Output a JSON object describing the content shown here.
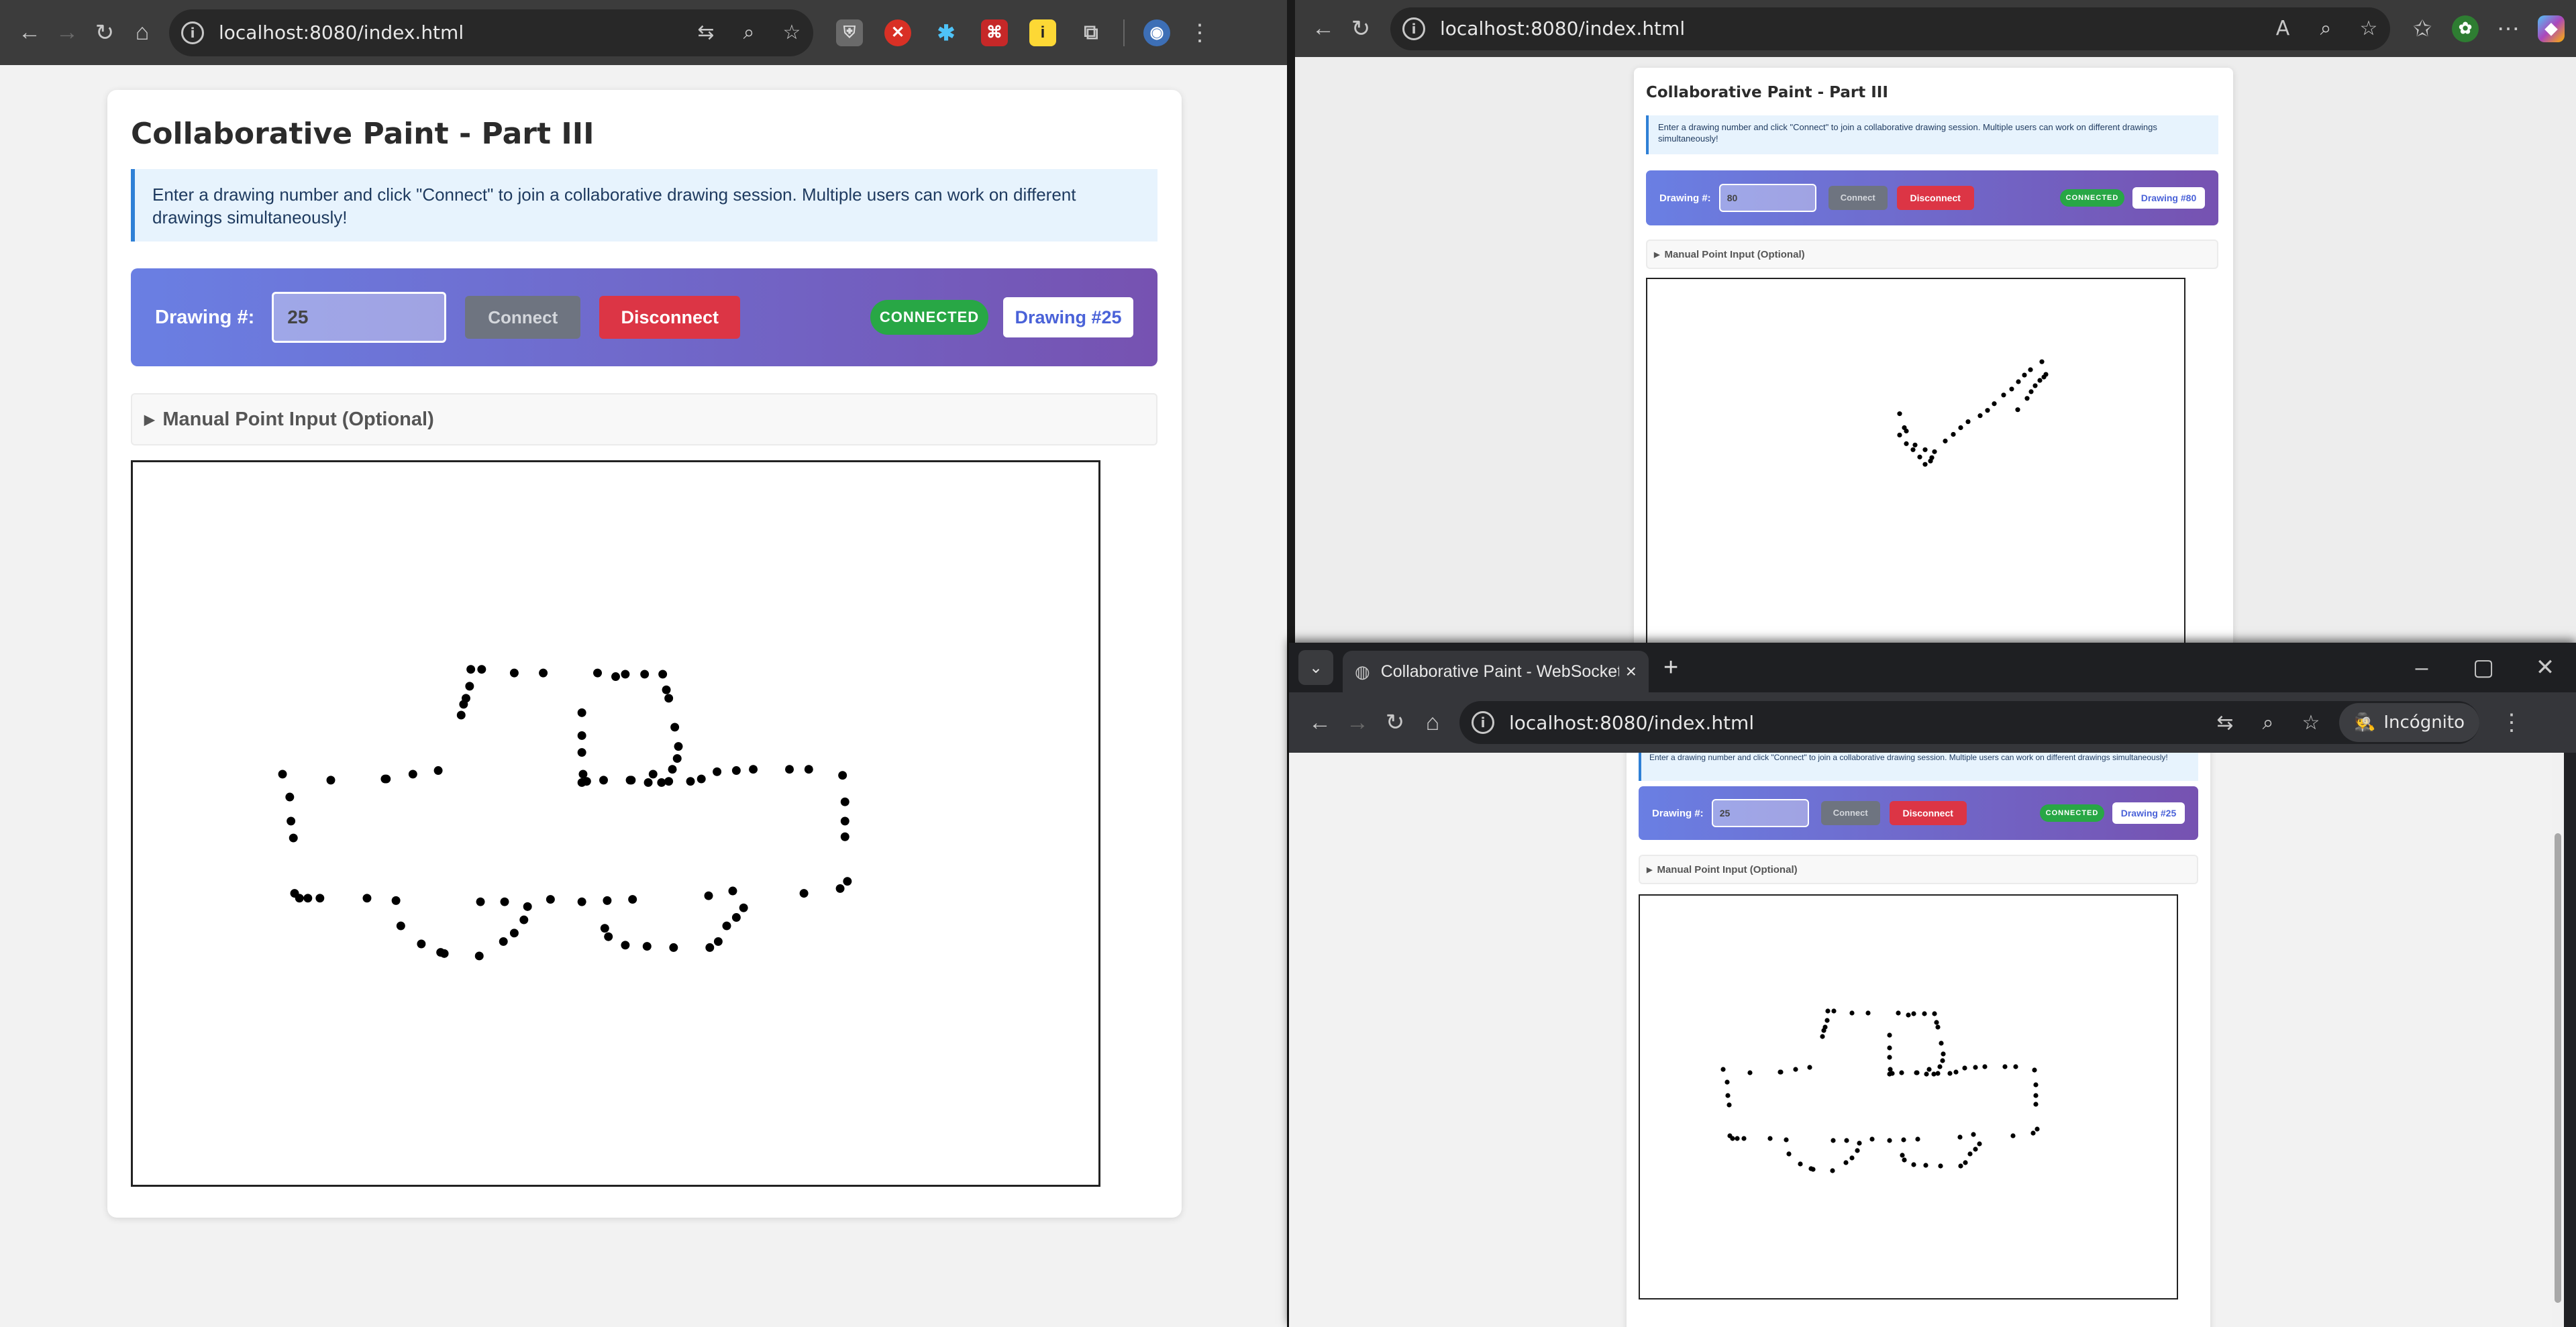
{
  "left_window": {
    "url": "localhost:8080/index.html",
    "page": {
      "title": "Collaborative Paint - Part III",
      "info": "Enter a drawing number and click \"Connect\" to join a collaborative drawing session. Multiple users can work on different drawings simultaneously!",
      "drawing_label": "Drawing #:",
      "drawing_value": "25",
      "connect_label": "Connect",
      "disconnect_label": "Disconnect",
      "status": "CONNECTED",
      "drawing_id": "Drawing #25",
      "manual_label": "Manual Point Input (Optional)"
    }
  },
  "right_top_window": {
    "url": "localhost:8080/index.html",
    "page": {
      "title": "Collaborative Paint - Part III",
      "info": "Enter a drawing number and click \"Connect\" to join a collaborative drawing session. Multiple users can work on different drawings simultaneously!",
      "drawing_label": "Drawing #:",
      "drawing_value": "80",
      "connect_label": "Connect",
      "disconnect_label": "Disconnect",
      "status": "CONNECTED",
      "drawing_id": "Drawing #80",
      "manual_label": "Manual Point Input (Optional)"
    }
  },
  "incognito_window": {
    "tab_title": "Collaborative Paint - WebSocket",
    "url": "localhost:8080/index.html",
    "incognito_label": "Incógnito",
    "page": {
      "info": "Enter a drawing number and click \"Connect\" to join a collaborative drawing session. Multiple users can work on different drawings simultaneously!",
      "drawing_label": "Drawing #:",
      "drawing_value": "25",
      "connect_label": "Connect",
      "disconnect_label": "Disconnect",
      "status": "CONNECTED",
      "drawing_id": "Drawing #25",
      "manual_label": "Manual Point Input (Optional)"
    }
  },
  "icons": {
    "back": "back-arrow-icon",
    "forward": "forward-arrow-icon",
    "reload": "reload-icon",
    "home": "home-icon",
    "translate": "translate-icon",
    "zoom": "zoom-icon",
    "bookmark": "star-icon",
    "extensions": "puzzle-icon",
    "menu": "kebab-menu-icon"
  },
  "colors": {
    "toolbar_start": "#6a7fe3",
    "toolbar_end": "#7652b1",
    "connected": "#28a745",
    "disconnect": "#dc3545",
    "info_border": "#2f80d6"
  }
}
